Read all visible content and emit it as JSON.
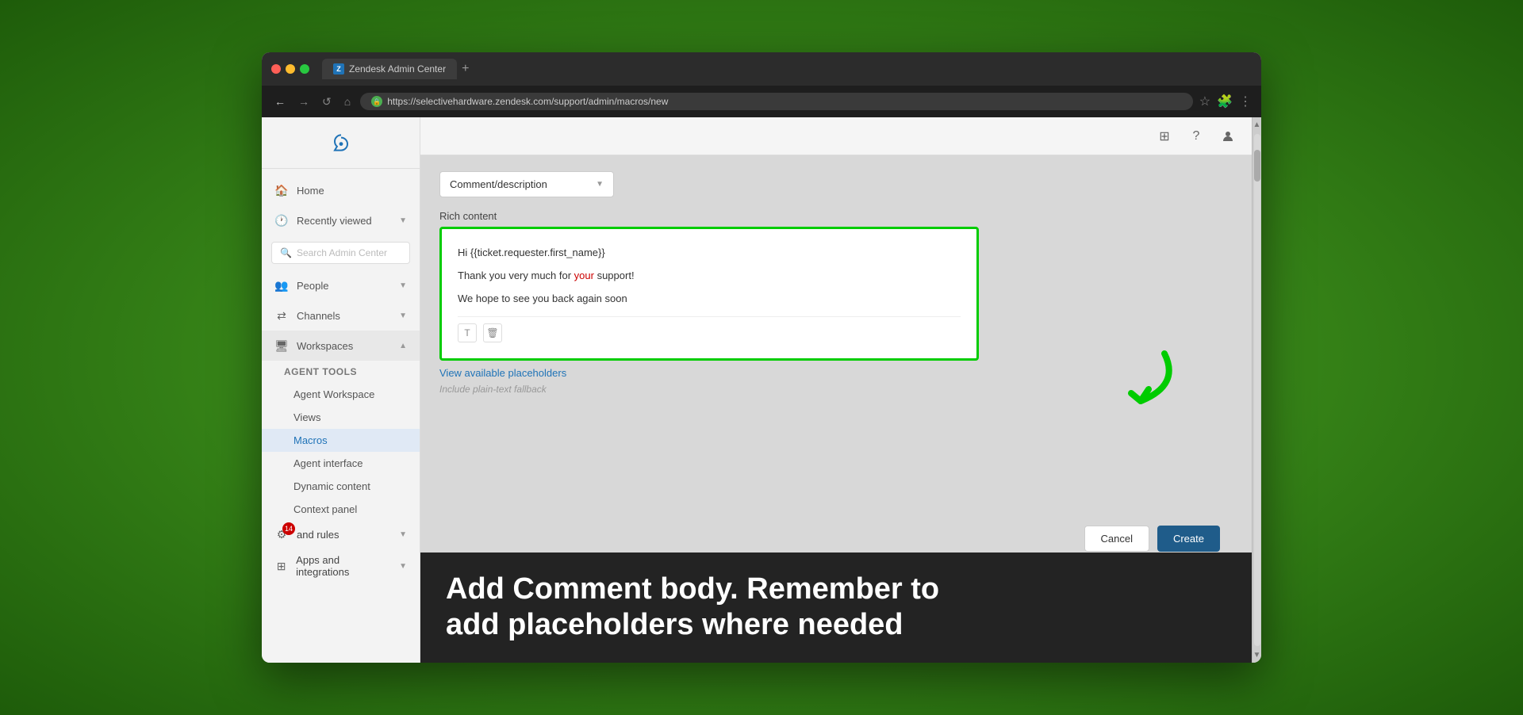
{
  "browser": {
    "tab_title": "Zendesk Admin Center",
    "tab_favicon": "Z",
    "url": "https://selectivehardware.zendesk.com/support/admin/macros/new",
    "plus_tab": "+"
  },
  "nav_buttons": {
    "back": "←",
    "forward": "→",
    "refresh": "↺",
    "home": "⌂"
  },
  "header_icons": {
    "grid": "⊞",
    "help": "?",
    "user": "👤"
  },
  "sidebar": {
    "logo_alt": "Zendesk",
    "home_label": "Home",
    "recently_viewed_label": "Recently viewed",
    "search_placeholder": "Search Admin Center",
    "people_label": "People",
    "channels_label": "Channels",
    "workspaces_label": "Workspaces",
    "agent_tools_label": "Agent tools",
    "agent_workspace_label": "Agent Workspace",
    "views_label": "Views",
    "macros_label": "Macros",
    "agent_interface_label": "Agent interface",
    "dynamic_content_label": "Dynamic content",
    "context_panel_label": "Context panel",
    "objects_and_rules_label": "and rules",
    "apps_and_integrations_label": "Apps and integrations",
    "badge_count": "14"
  },
  "content": {
    "dropdown_label": "Comment/description",
    "rich_content_section": "Rich content",
    "line1": "Hi {{ticket.requester.first_name}}",
    "line2_prefix": "Thank you very much for ",
    "line2_highlight": "your",
    "line2_suffix": " support!",
    "line3": "We hope to see you back again soon",
    "view_placeholders_link": "View available placeholders",
    "plain_text_label": "Include plain-text fallback",
    "cancel_btn": "Cancel",
    "create_btn": "Create"
  },
  "banner": {
    "text_line1": "Add Comment body. Remember to",
    "text_line2": "add placeholders where needed"
  },
  "icons": {
    "trash": "🗑",
    "copy": "⧉",
    "search_mag": "🔍"
  }
}
